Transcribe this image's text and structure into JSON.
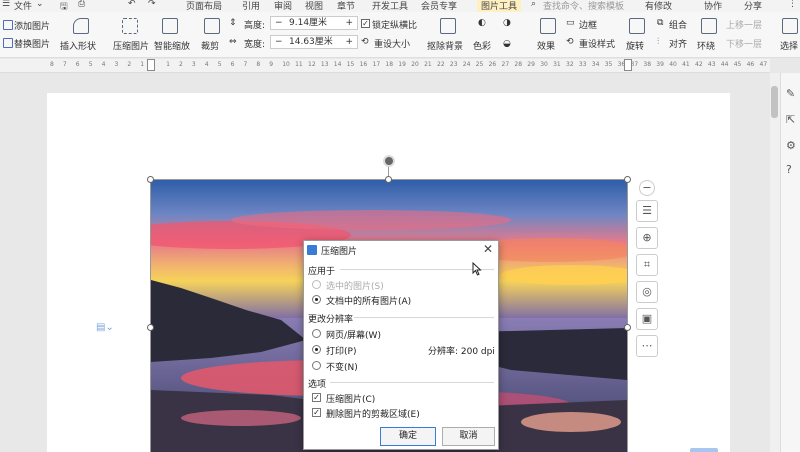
{
  "menubar": {
    "items": [
      "文件",
      "页面布局",
      "引用",
      "审阅",
      "视图",
      "章节",
      "开发工具",
      "会员专享",
      "图片工具"
    ],
    "search_placeholder": "查找命令、搜索模板",
    "right": [
      "有修改",
      "协作",
      "分享"
    ]
  },
  "ribbon": {
    "add_picture": "添加图片",
    "replace_picture": "替换图片",
    "insert_shape": "插入形状",
    "compress_picture": "压缩图片",
    "smart_zoom": "智能缩放",
    "crop": "裁剪",
    "height_label": "高度:",
    "height_value": "9.14厘米",
    "width_label": "宽度:",
    "width_value": "14.63厘米",
    "lock_ratio": "锁定纵横比",
    "reset_size": "重设大小",
    "remove_bg": "抠除背景",
    "color": "色彩",
    "effects": "效果",
    "border": "边框",
    "reset_style": "重设样式",
    "rotate": "旋转",
    "group": "组合",
    "align": "对齐",
    "wrap": "环绕",
    "move_up": "上移一层",
    "move_down": "下移一层",
    "select": "选择"
  },
  "ruler": {
    "ticks": [
      "8",
      "7",
      "6",
      "5",
      "4",
      "3",
      "2",
      "1",
      "",
      "1",
      "2",
      "3",
      "4",
      "5",
      "6",
      "7",
      "8",
      "9",
      "10",
      "11",
      "12",
      "13",
      "14",
      "15",
      "16",
      "17",
      "18",
      "19",
      "20",
      "21",
      "22",
      "23",
      "24",
      "25",
      "26",
      "27",
      "28",
      "29",
      "30",
      "31",
      "32",
      "33",
      "34",
      "35",
      "36",
      "37",
      "38",
      "39",
      "40",
      "41",
      "42",
      "43",
      "44",
      "45",
      "46",
      "47"
    ]
  },
  "dialog": {
    "title": "压缩图片",
    "apply_to_label": "应用于",
    "opt_selected_picture": "选中的图片(S)",
    "opt_all_pictures": "文档中的所有图片(A)",
    "change_resolution_label": "更改分辨率",
    "opt_web_screen": "网页/屏幕(W)",
    "opt_print": "打印(P)",
    "resolution_text": "分辨率: 200 dpi",
    "opt_no_change": "不变(N)",
    "options_label": "选项",
    "chk_compress": "压缩图片(C)",
    "chk_delete_crop": "删除图片的剪裁区域(E)",
    "ok_label": "确定",
    "cancel_label": "取消"
  },
  "colors": {
    "accent": "#3a7bd5",
    "picture_tools_tab": "#fff0c2"
  }
}
